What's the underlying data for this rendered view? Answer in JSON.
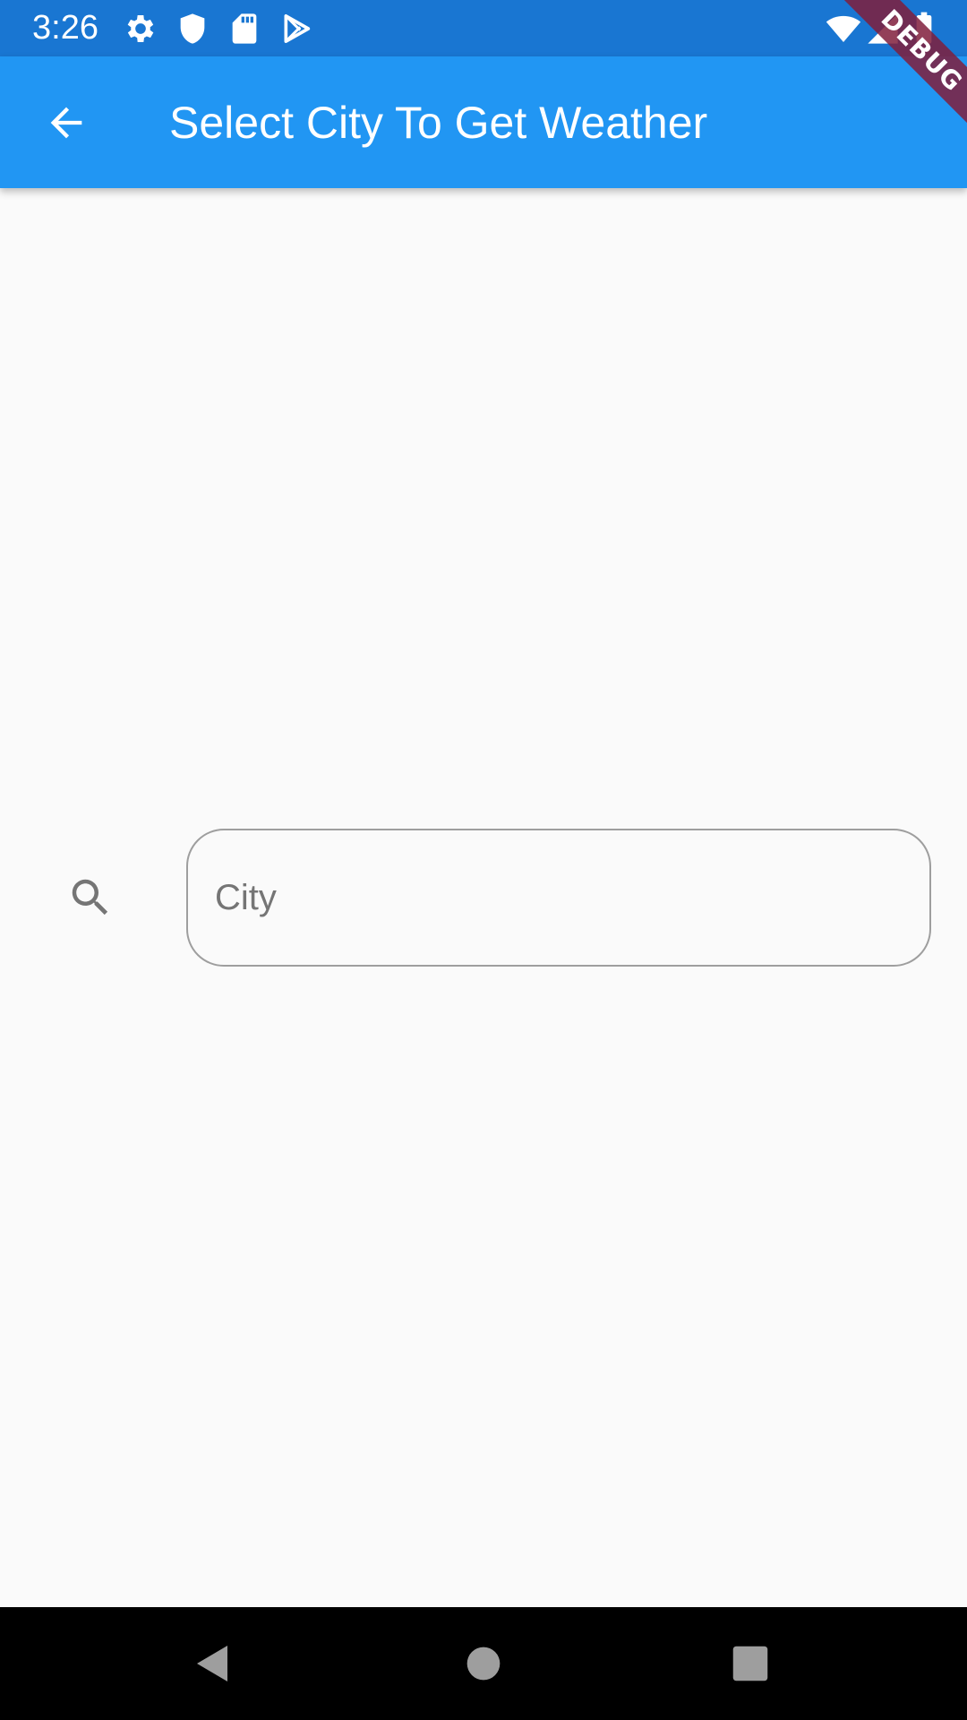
{
  "status_bar": {
    "time": "3:26",
    "left_icons": [
      "gear-icon",
      "shield-icon",
      "sd-card-icon",
      "play-store-icon"
    ],
    "right_icons": [
      "wifi-icon",
      "signal-icon",
      "battery-icon"
    ],
    "color": "#1976D2"
  },
  "app_bar": {
    "title": "Select City To Get Weather",
    "back_icon": "arrow-back-icon",
    "color": "#2196F3"
  },
  "debug_banner": {
    "label": "DEBUG"
  },
  "search": {
    "icon": "search-icon",
    "placeholder": "City",
    "value": ""
  },
  "nav_bar": {
    "buttons": [
      "back-triangle-icon",
      "home-circle-icon",
      "recents-square-icon"
    ]
  },
  "colors": {
    "background": "#FAFAFA",
    "primary": "#2196F3",
    "primary_dark": "#1976D2",
    "banner": "#801E3C"
  }
}
